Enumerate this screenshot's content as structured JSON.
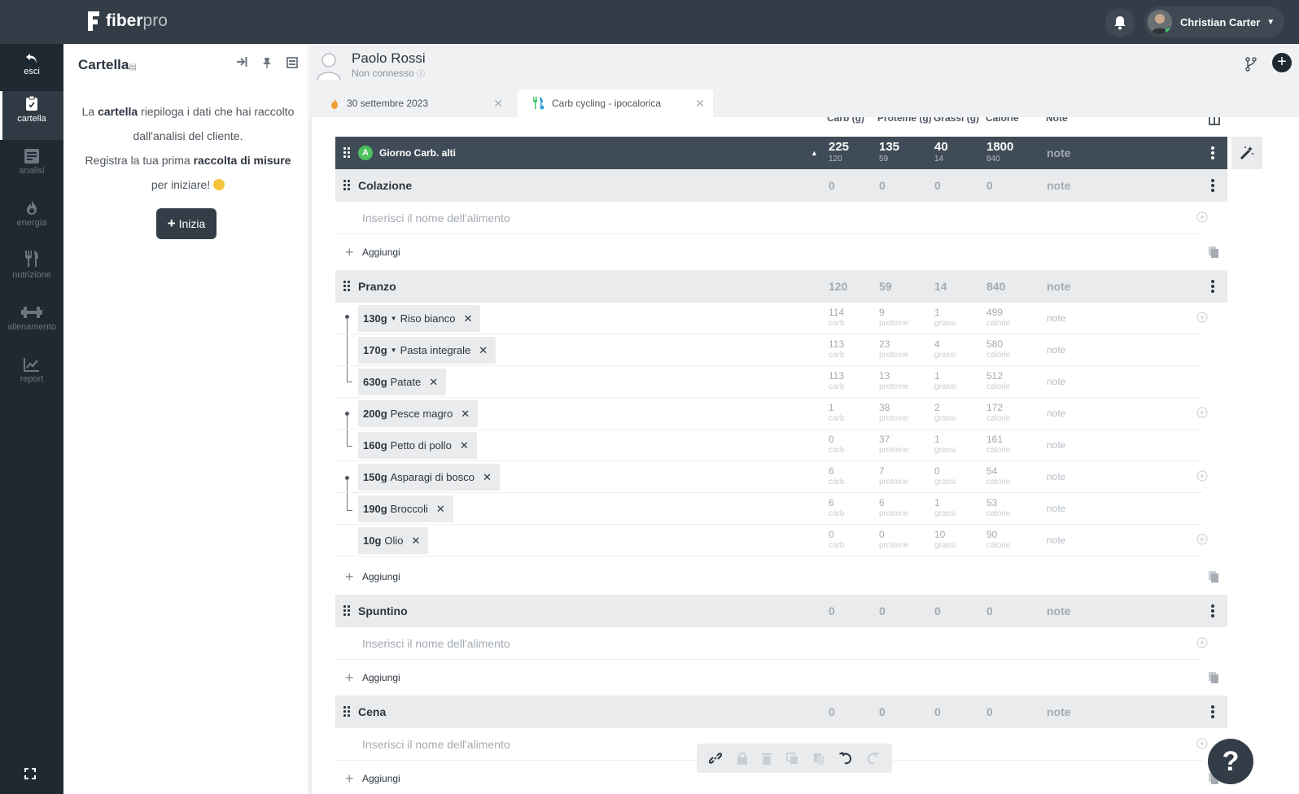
{
  "app": {
    "brand_main": "fiber",
    "brand_sub": "pro"
  },
  "user": {
    "name": "Christian Carter"
  },
  "nav": [
    {
      "label": "esci"
    },
    {
      "label": "cartella"
    },
    {
      "label": "analisi"
    },
    {
      "label": "energia"
    },
    {
      "label": "nutrizione"
    },
    {
      "label": "allenamento"
    },
    {
      "label": "report"
    }
  ],
  "panel": {
    "title": "Cartella",
    "line1_pre": "La ",
    "line1_bold": "cartella",
    "line1_post": " riepiloga i dati che hai raccolto dall'analisi del cliente.",
    "line2_pre": "Registra la tua prima ",
    "line2_bold": "raccolta di misure",
    "line2_post": " per iniziare!",
    "button": "Inizia"
  },
  "client": {
    "name": "Paolo Rossi",
    "status": "Non connesso"
  },
  "tabs": [
    {
      "label": "30 settembre 2023"
    },
    {
      "label": "Carb cycling - ipocalorica"
    }
  ],
  "columns": {
    "carb": "Carb (g)",
    "prot": "Proteine (g)",
    "fat": "Grassi (g)",
    "cal": "Calorie",
    "note": "Note"
  },
  "day": {
    "badge": "A",
    "title": "Giorno Carb. alti",
    "carb": "225",
    "carb_sub": "120",
    "prot": "135",
    "prot_sub": "59",
    "fat": "40",
    "fat_sub": "14",
    "cal": "1800",
    "cal_sub": "840",
    "note": "note"
  },
  "placeholder": "Inserisci il nome dell'alimento",
  "add_label": "Aggiungi",
  "note_label": "note",
  "units": {
    "carb": "carb",
    "prot": "proteine",
    "fat": "grassi",
    "cal": "calorie"
  },
  "meals": {
    "colazione": {
      "title": "Colazione",
      "carb": "0",
      "prot": "0",
      "fat": "0",
      "cal": "0"
    },
    "pranzo": {
      "title": "Pranzo",
      "carb": "120",
      "prot": "59",
      "fat": "14",
      "cal": "840"
    },
    "spuntino": {
      "title": "Spuntino",
      "carb": "0",
      "prot": "0",
      "fat": "0",
      "cal": "0"
    },
    "cena": {
      "title": "Cena",
      "carb": "0",
      "prot": "0",
      "fat": "0",
      "cal": "0"
    }
  },
  "foods": [
    {
      "qty": "130g",
      "name": "Riso bianco",
      "carb": "114",
      "prot": "9",
      "fat": "1",
      "cal": "499"
    },
    {
      "qty": "170g",
      "name": "Pasta integrale",
      "carb": "113",
      "prot": "23",
      "fat": "4",
      "cal": "580"
    },
    {
      "qty": "630g",
      "name": "Patate",
      "carb": "113",
      "prot": "13",
      "fat": "1",
      "cal": "512"
    },
    {
      "qty": "200g",
      "name": "Pesce magro",
      "carb": "1",
      "prot": "38",
      "fat": "2",
      "cal": "172"
    },
    {
      "qty": "160g",
      "name": "Petto di pollo",
      "carb": "0",
      "prot": "37",
      "fat": "1",
      "cal": "161"
    },
    {
      "qty": "150g",
      "name": "Asparagi di bosco",
      "carb": "6",
      "prot": "7",
      "fat": "0",
      "cal": "54"
    },
    {
      "qty": "190g",
      "name": "Broccoli",
      "carb": "6",
      "prot": "6",
      "fat": "1",
      "cal": "53"
    },
    {
      "qty": "10g",
      "name": "Olio",
      "carb": "0",
      "prot": "0",
      "fat": "10",
      "cal": "90"
    }
  ],
  "help": "?"
}
